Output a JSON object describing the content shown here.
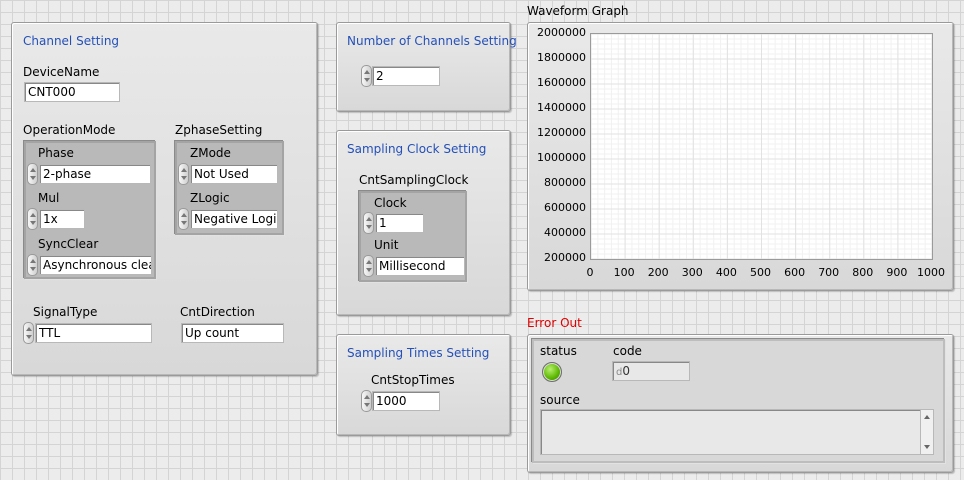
{
  "channel_setting": {
    "title": "Channel Setting",
    "device_name_label": "DeviceName",
    "device_name_value": "CNT000",
    "operation_mode": {
      "label": "OperationMode",
      "phase_label": "Phase",
      "phase_value": "2-phase",
      "mul_label": "Mul",
      "mul_value": "1x",
      "sync_clear_label": "SyncClear",
      "sync_clear_value": "Asynchronous clear"
    },
    "zphase_setting": {
      "label": "ZphaseSetting",
      "zmode_label": "ZMode",
      "zmode_value": "Not Used",
      "zlogic_label": "ZLogic",
      "zlogic_value": "Negative Logic"
    },
    "signal_type_label": "SignalType",
    "signal_type_value": "TTL",
    "cnt_direction_label": "CntDirection",
    "cnt_direction_value": "Up count"
  },
  "channels_setting": {
    "title": "Number of Channels Setting",
    "value": "2"
  },
  "sampling_clock_setting": {
    "title": "Sampling Clock Setting",
    "cluster_label": "CntSamplingClock",
    "clock_label": "Clock",
    "clock_value": "1",
    "unit_label": "Unit",
    "unit_value": "Millisecond"
  },
  "sampling_times_setting": {
    "title": "Sampling Times Setting",
    "label": "CntStopTimes",
    "value": "1000"
  },
  "waveform_graph": {
    "title": "Waveform Graph"
  },
  "chart_data": {
    "type": "line",
    "title": "Waveform Graph",
    "xlabel": "",
    "ylabel": "",
    "xlim": [
      0,
      1000
    ],
    "ylim": [
      200000,
      2000000
    ],
    "x_ticks": [
      "0",
      "100",
      "200",
      "300",
      "400",
      "500",
      "600",
      "700",
      "800",
      "900",
      "1000"
    ],
    "y_ticks": [
      "2000000",
      "1800000",
      "1600000",
      "1400000",
      "1200000",
      "1000000",
      "800000",
      "600000",
      "400000",
      "200000"
    ],
    "grid": true,
    "series": []
  },
  "error_out": {
    "title": "Error Out",
    "status_label": "status",
    "status_color": "#5cb800",
    "code_label": "code",
    "code_prefix": "d",
    "code_value": "0",
    "source_label": "source",
    "source_value": ""
  },
  "colors": {
    "title_blue": "#2450b8",
    "error_red": "#e00000"
  }
}
